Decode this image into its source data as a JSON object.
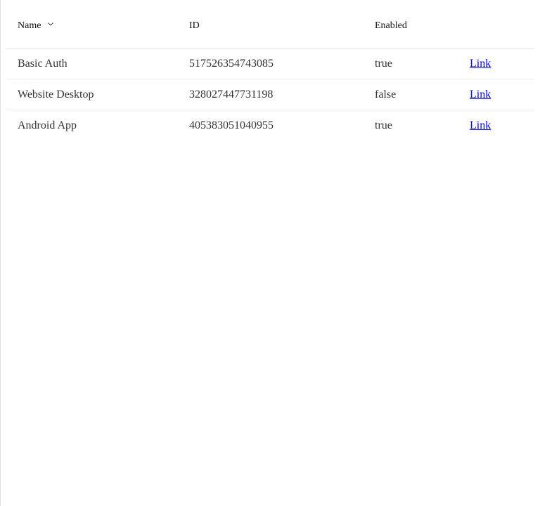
{
  "table": {
    "columns": {
      "name": "Name",
      "id": "ID",
      "enabled": "Enabled"
    },
    "sort": {
      "column": "Name",
      "icon": "chevron-down-icon"
    },
    "rows": [
      {
        "name": "Basic Auth",
        "id": "517526354743085",
        "enabled": "true",
        "link": "Link"
      },
      {
        "name": "Website Desktop",
        "id": "328027447731198",
        "enabled": "false",
        "link": "Link"
      },
      {
        "name": "Android App",
        "id": "405383051040955",
        "enabled": "true",
        "link": "Link"
      }
    ]
  },
  "colors": {
    "link": "#0000ee",
    "row_divider": "#ececec",
    "text": "#333333"
  }
}
